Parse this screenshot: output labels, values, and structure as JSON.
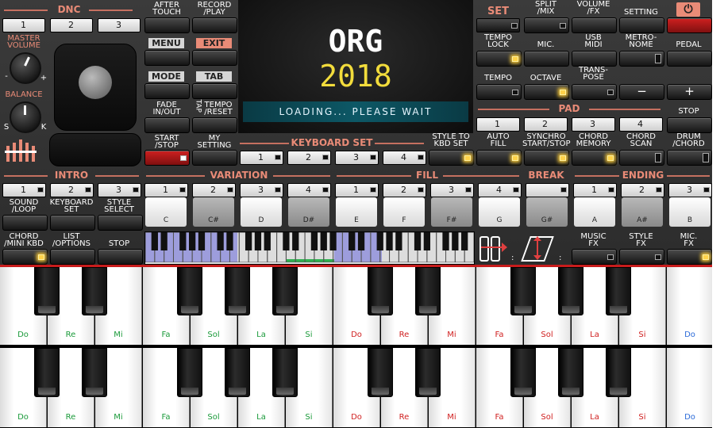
{
  "header": {
    "dnc": "DNC",
    "dnc_buttons": [
      "1",
      "2",
      "3"
    ],
    "after_touch": "AFTER\nTOUCH",
    "record_play": "RECORD\n/PLAY",
    "menu": "MENU",
    "exit": "EXIT",
    "mode": "MODE",
    "tab": "TAB",
    "fade": "FADE\nIN/OUT",
    "tap": "TAP",
    "tempo_reset": "TEMPO\n/RESET",
    "start_stop": "START\n/STOP",
    "my_setting": "MY\nSETTING",
    "master_volume": "MASTER\nVOLUME",
    "balance": "BALANCE",
    "minus": "-",
    "plus": "+",
    "s": "S",
    "k": "K"
  },
  "screen": {
    "title": "ORG",
    "year": "2018",
    "status": "LOADING... PLEASE WAIT"
  },
  "right": {
    "set": "SET",
    "split_mix": "SPLIT\n/MIX",
    "volume_fx": "VOLUME\n/FX",
    "setting": "SETTING",
    "power_icon": "⏻",
    "tempo_lock": "TEMPO\nLOCK",
    "mic": "MIC.",
    "usb_midi": "USB\nMIDI",
    "metronome": "METRO-\nNOME",
    "pedal": "PEDAL",
    "tempo": "TEMPO",
    "octave": "OCTAVE",
    "transpose": "TRANS-\nPOSE",
    "minus": "−",
    "plus": "+",
    "pad": "PAD",
    "stop": "STOP",
    "pad_buttons": [
      "1",
      "2",
      "3",
      "4"
    ],
    "auto_fill": "AUTO\nFILL",
    "synchro": "SYNCHRO\nSTART/STOP",
    "chord_memory": "CHORD\nMEMORY",
    "chord_scan": "CHORD\nSCAN",
    "drum_chord": "DRUM\n/CHORD",
    "style_to_kbd": "STYLE TO\nKBD SET"
  },
  "keyboard_set": {
    "label": "KEYBOARD SET",
    "buttons": [
      "1",
      "2",
      "3",
      "4"
    ]
  },
  "sections": {
    "intro": "INTRO",
    "variation": "VARIATION",
    "fill": "FILL",
    "break": "BREAK",
    "ending": "ENDING",
    "intro_buttons": [
      "1",
      "2",
      "3"
    ],
    "variation_buttons": [
      "1",
      "2",
      "3",
      "4"
    ],
    "fill_buttons": [
      "1",
      "2",
      "3",
      "4"
    ],
    "ending_buttons": [
      "1",
      "2",
      "3"
    ]
  },
  "lower_left": {
    "sound_loop": "SOUND\n/LOOP",
    "keyboard_set": "KEYBOARD\nSET",
    "style_select": "STYLE\nSELECT",
    "chord_mini": "CHORD\n/MINI KBD",
    "list_options": "LIST\n/OPTIONS",
    "stop": "STOP"
  },
  "notes": [
    "C",
    "C#",
    "D",
    "D#",
    "E",
    "F",
    "F#",
    "G",
    "G#",
    "A",
    "A#",
    "B"
  ],
  "lower_right": {
    "music_fx": "MUSIC\nFX",
    "style_fx": "STYLE\nFX",
    "mic_fx": "MIC.\nFX"
  },
  "solfege": [
    "Do",
    "Re",
    "Mi",
    "Fa",
    "Sol",
    "La",
    "Si",
    "Do",
    "Re",
    "Mi",
    "Fa",
    "Sol",
    "La",
    "Si",
    "Do"
  ],
  "colors": {
    "accent": "#e98b77",
    "solfege_green": "#1a9a3a",
    "solfege_red": "#d02020",
    "solfege_blue": "#2a6ad8"
  }
}
